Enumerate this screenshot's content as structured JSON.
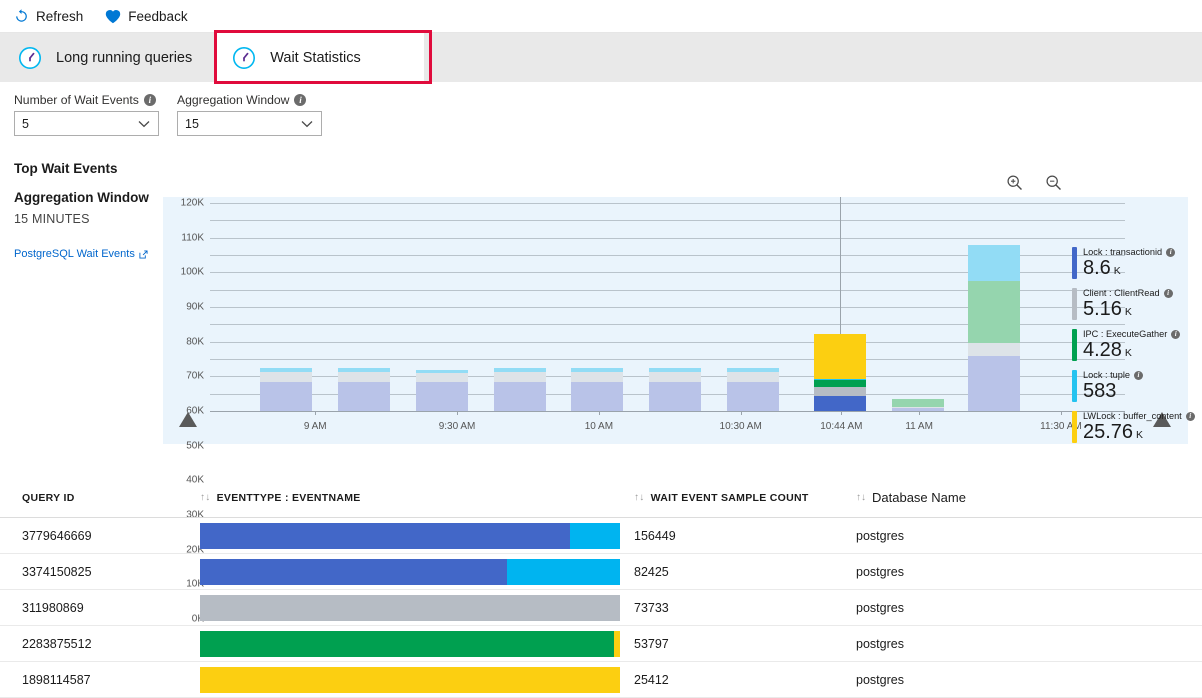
{
  "commandbar": {
    "items": [
      {
        "label": "Refresh",
        "icon": "refresh-icon"
      },
      {
        "label": "Feedback",
        "icon": "heart-icon"
      }
    ]
  },
  "tabs": [
    {
      "label": "Long running queries",
      "icon": "clock-icon",
      "selected": false
    },
    {
      "label": "Wait Statistics",
      "icon": "clock-icon",
      "selected": true
    }
  ],
  "filters": [
    {
      "label": "Number of Wait Events",
      "value": "5",
      "info": "info-icon"
    },
    {
      "label": "Aggregation Window",
      "value": "15",
      "info": "info-icon"
    }
  ],
  "section": {
    "title": "Top Wait Events"
  },
  "leftpane": {
    "agg_title": "Aggregation Window",
    "agg_value": "15 MINUTES",
    "link": "PostgreSQL Wait Events"
  },
  "zoom_controls": [
    {
      "name": "zoom-in-icon"
    },
    {
      "name": "zoom-out-icon"
    }
  ],
  "chart_data": {
    "type": "bar",
    "stacked": true,
    "title": "Top Wait Events",
    "xlabel": "",
    "ylabel": "",
    "ylim": [
      0,
      120000
    ],
    "grid": true,
    "legend_position": "right",
    "ytick_labels": [
      "0K",
      "10K",
      "20K",
      "30K",
      "40K",
      "50K",
      "60K",
      "70K",
      "80K",
      "90K",
      "100K",
      "110K",
      "120K"
    ],
    "ytick_values": [
      0,
      10000,
      20000,
      30000,
      40000,
      50000,
      60000,
      70000,
      80000,
      90000,
      100000,
      110000,
      120000
    ],
    "xtick_labels": [
      "9 AM",
      "9:30 AM",
      "10 AM",
      "10:30 AM",
      "10:44 AM",
      "11 AM",
      "11:30 AM"
    ],
    "xtick_positions": [
      0.115,
      0.27,
      0.425,
      0.58,
      0.69,
      0.775,
      0.93
    ],
    "cursor_label": "10:44 AM",
    "series": [
      {
        "name": "Lock : transactionid",
        "color": "#4267c8",
        "faded": "#b9c3e8"
      },
      {
        "name": "Client : ClientRead",
        "color": "#b6bcc4",
        "faded": "#dde3e8"
      },
      {
        "name": "IPC : ExecuteGather",
        "color": "#00a050",
        "faded": "#95d5ae"
      },
      {
        "name": "Lock : tuple",
        "color": "#25c3f0",
        "faded": "#92dcf5"
      },
      {
        "name": "LWLock : buffer_content",
        "color": "#fccf11",
        "faded": "#fdeba0"
      }
    ],
    "bars": [
      {
        "x": 0.055,
        "highlighted": false,
        "values": [
          17000,
          5500,
          0,
          2200,
          0
        ]
      },
      {
        "x": 0.14,
        "highlighted": false,
        "values": [
          17000,
          5500,
          0,
          2200,
          0
        ]
      },
      {
        "x": 0.225,
        "highlighted": false,
        "values": [
          16500,
          5200,
          0,
          2200,
          0
        ]
      },
      {
        "x": 0.31,
        "highlighted": false,
        "values": [
          17000,
          5500,
          0,
          2200,
          0
        ]
      },
      {
        "x": 0.395,
        "highlighted": false,
        "values": [
          17000,
          5500,
          0,
          2200,
          0
        ]
      },
      {
        "x": 0.48,
        "highlighted": false,
        "values": [
          17000,
          5500,
          0,
          2200,
          0
        ]
      },
      {
        "x": 0.565,
        "highlighted": false,
        "values": [
          17000,
          5500,
          0,
          2200,
          0
        ]
      },
      {
        "x": 0.66,
        "highlighted": true,
        "values": [
          8600,
          5160,
          4280,
          583,
          25760
        ]
      },
      {
        "x": 0.745,
        "highlighted": false,
        "values": [
          2000,
          500,
          4200,
          0,
          0
        ]
      },
      {
        "x": 0.828,
        "highlighted": false,
        "values": [
          32000,
          7000,
          36000,
          21000,
          0
        ]
      }
    ],
    "range_handles": [
      0.0245,
      0.9745
    ]
  },
  "legend": [
    {
      "name": "Lock : transactionid",
      "value": "8.6",
      "unit": "K",
      "color": "#4267c8"
    },
    {
      "name": "Client : ClientRead",
      "value": "5.16",
      "unit": "K",
      "color": "#b6bcc4"
    },
    {
      "name": "IPC : ExecuteGather",
      "value": "4.28",
      "unit": "K",
      "color": "#00a050"
    },
    {
      "name": "Lock : tuple",
      "value": "583",
      "unit": "",
      "color": "#25c3f0"
    },
    {
      "name": "LWLock : buffer_content",
      "value": "25.76",
      "unit": "K",
      "color": "#fccf11"
    }
  ],
  "table": {
    "columns": [
      {
        "label": "QUERY ID",
        "sortable": false,
        "style": "caps"
      },
      {
        "label": "EVENTTYPE : EVENTNAME",
        "sortable": true,
        "style": "caps"
      },
      {
        "label": "WAIT EVENT SAMPLE COUNT",
        "sortable": true,
        "style": "caps"
      },
      {
        "label": "Database Name",
        "sortable": true,
        "style": "plain"
      }
    ],
    "rows": [
      {
        "query_id": "3779646669",
        "count": "156449",
        "database": "postgres",
        "segments": [
          {
            "color": "#4267c8",
            "pct": 88
          },
          {
            "color": "#00b4f0",
            "pct": 12
          }
        ]
      },
      {
        "query_id": "3374150825",
        "count": "82425",
        "database": "postgres",
        "segments": [
          {
            "color": "#4267c8",
            "pct": 73
          },
          {
            "color": "#00b4f0",
            "pct": 27
          }
        ]
      },
      {
        "query_id": "311980869",
        "count": "73733",
        "database": "postgres",
        "segments": [
          {
            "color": "#b6bcc4",
            "pct": 100
          }
        ]
      },
      {
        "query_id": "2283875512",
        "count": "53797",
        "database": "postgres",
        "segments": [
          {
            "color": "#00a050",
            "pct": 98.5
          },
          {
            "color": "#fccf11",
            "pct": 1.5
          }
        ]
      },
      {
        "query_id": "1898114587",
        "count": "25412",
        "database": "postgres",
        "segments": [
          {
            "color": "#fccf11",
            "pct": 100
          }
        ]
      }
    ]
  }
}
